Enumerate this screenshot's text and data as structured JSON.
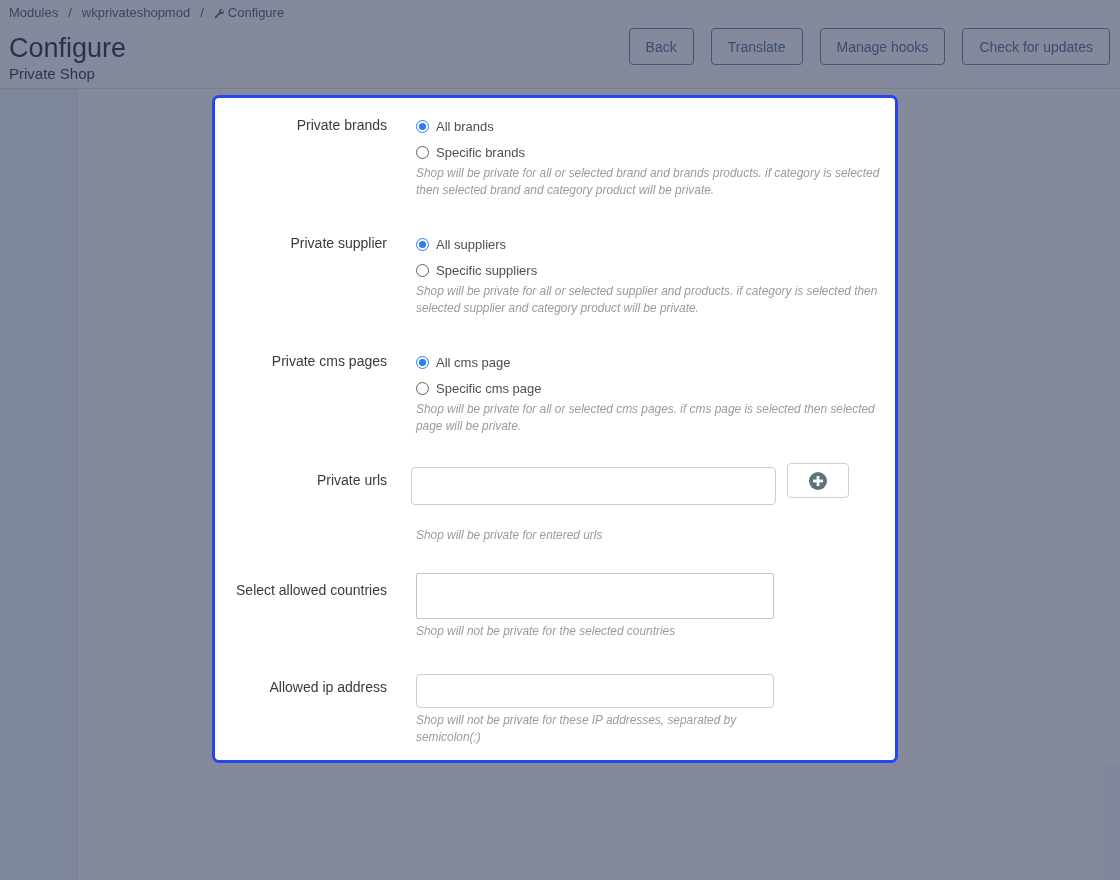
{
  "breadcrumb": {
    "items": [
      {
        "label": "Modules",
        "kind": "link"
      },
      {
        "label": "wkprivateshopmod",
        "kind": "link"
      },
      {
        "label": "Configure",
        "kind": "current"
      }
    ],
    "separators": [
      "/",
      "/"
    ]
  },
  "header": {
    "title": "Configure",
    "subtitle": "Private Shop",
    "buttons": [
      "Back",
      "Translate",
      "Manage hooks",
      "Check for updates"
    ]
  },
  "form": {
    "fields": [
      {
        "kind": "radio",
        "label": "Private brands",
        "options": [
          {
            "label": "All brands",
            "selected": true
          },
          {
            "label": "Specific brands",
            "selected": false
          }
        ],
        "help": "Shop will be private for all or selected brand and brands products. if category is selected then selected brand and category product will be private."
      },
      {
        "kind": "radio",
        "label": "Private supplier",
        "options": [
          {
            "label": "All suppliers",
            "selected": true
          },
          {
            "label": "Specific suppliers",
            "selected": false
          }
        ],
        "help": "Shop will be private for all or selected supplier and products. if category is selected then selected supplier and category product will be private."
      },
      {
        "kind": "radio",
        "label": "Private cms pages",
        "options": [
          {
            "label": "All cms page",
            "selected": true
          },
          {
            "label": "Specific cms page",
            "selected": false
          }
        ],
        "help": "Shop will be private for all or selected cms pages. if cms page is selected then selected page will be private."
      },
      {
        "kind": "url_list",
        "label": "Private urls",
        "help": "Shop will be private for entered urls"
      },
      {
        "kind": "multiselect",
        "label": "Select allowed countries",
        "help": "Shop will not be private for the selected countries"
      },
      {
        "kind": "text",
        "label": "Allowed ip address",
        "help": "Shop will not be private for these IP addresses, separated by semicolon(;)"
      }
    ]
  }
}
